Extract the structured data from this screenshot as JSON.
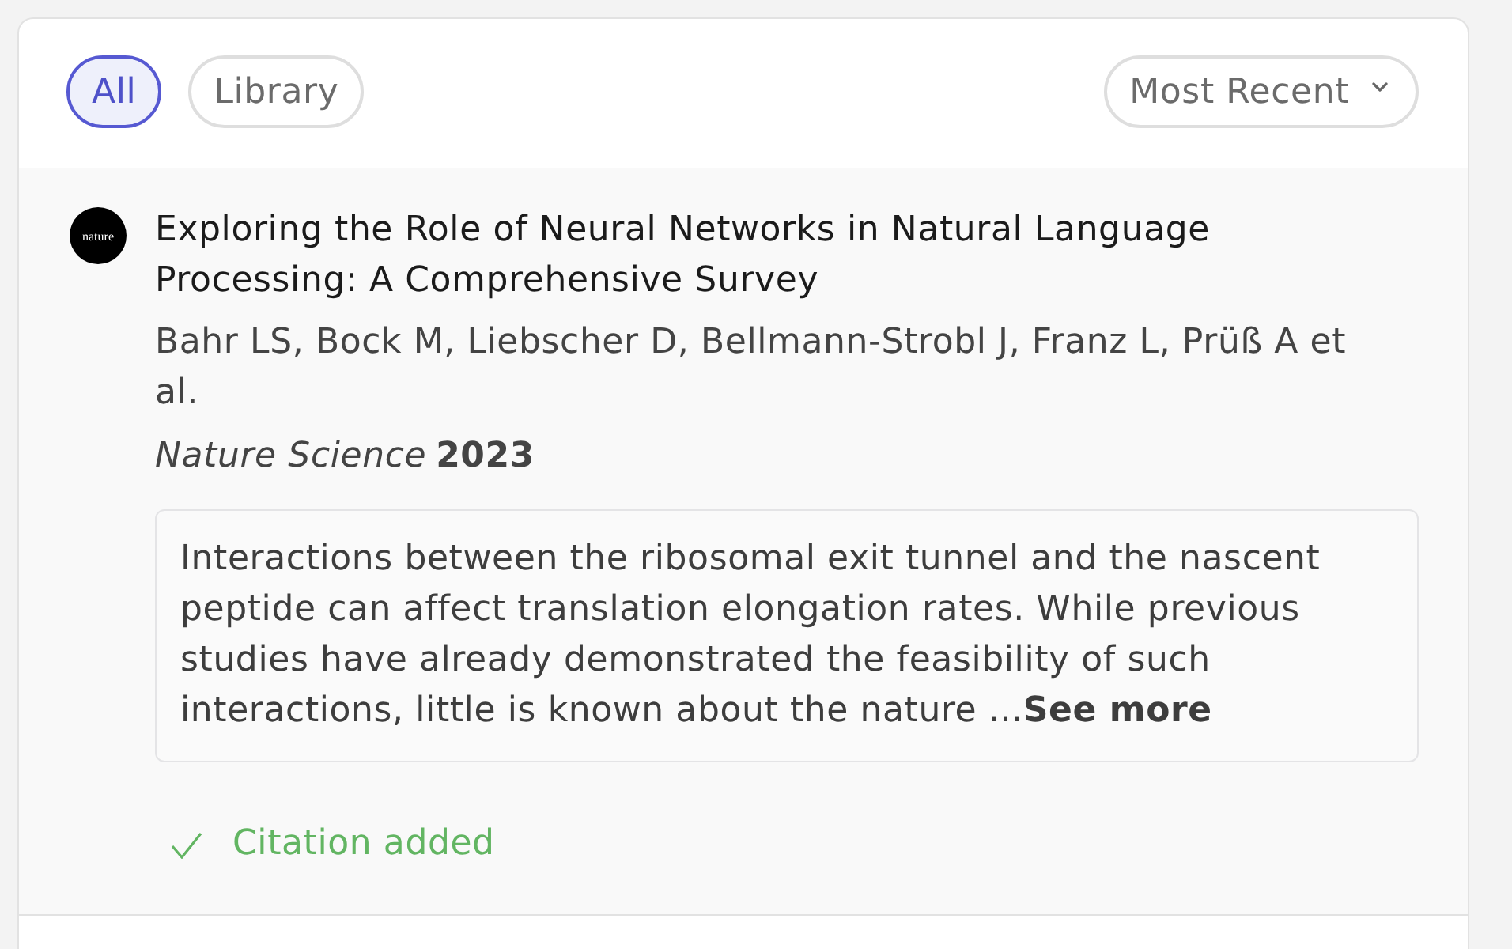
{
  "filters": [
    {
      "label": "All",
      "selected": true
    },
    {
      "label": "Library",
      "selected": false
    }
  ],
  "sort": {
    "label": "Most Recent"
  },
  "results": [
    {
      "logo_text": "nature",
      "title": "Exploring the Role of Neural Networks in Natural Language Processing: A Comprehensive Survey",
      "authors": "Bahr LS, Bock M, Liebscher D, Bellmann-Strobl J, Franz L, Prüß A et al.",
      "journal": "Nature Science",
      "year": "2023",
      "abstract": "Interactions between the ribosomal exit tunnel and the nascent peptide can affect translation elongation rates. While previous studies have already demonstrated the feasibility of such interactions, little is known about the nature ...",
      "see_more": "See more",
      "status": "Citation added"
    }
  ]
}
